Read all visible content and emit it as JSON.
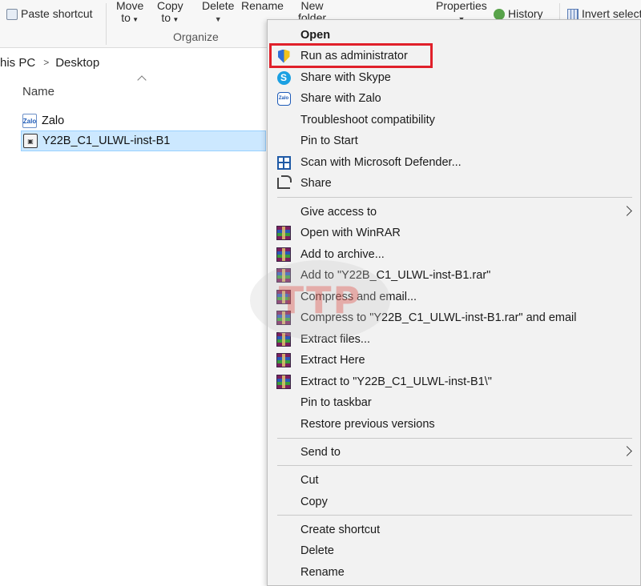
{
  "ribbon": {
    "paste_shortcut": "Paste shortcut",
    "move_to": [
      "Move",
      "to"
    ],
    "copy_to": [
      "Copy",
      "to"
    ],
    "delete": "Delete",
    "rename": "Rename",
    "new_folder": [
      "New",
      "folder"
    ],
    "properties": "Properties",
    "history": "History",
    "invert_selection": "Invert select",
    "organize_label": "Organize"
  },
  "address": {
    "segments": [
      "his PC",
      "Desktop"
    ]
  },
  "file_list": {
    "column_name": "Name",
    "files": [
      {
        "name": "Zalo",
        "icon": "zalo-icon",
        "selected": false
      },
      {
        "name": "Y22B_C1_ULWL-inst-B1",
        "icon": "installer-icon",
        "selected": true
      }
    ]
  },
  "context_menu": {
    "items": [
      {
        "label": "Open",
        "bold": true,
        "icon": null
      },
      {
        "label": "Run as administrator",
        "icon": "uac-shield-icon",
        "highlighted": true
      },
      {
        "label": "Share with Skype",
        "icon": "skype-icon"
      },
      {
        "label": "Share with Zalo",
        "icon": "zalo-icon"
      },
      {
        "label": "Troubleshoot compatibility",
        "icon": null
      },
      {
        "label": "Pin to Start",
        "icon": null
      },
      {
        "label": "Scan with Microsoft Defender...",
        "icon": "defender-icon"
      },
      {
        "label": "Share",
        "icon": "share-icon"
      },
      {
        "label": "Give access to",
        "icon": null,
        "submenu": true
      },
      {
        "label": "Open with WinRAR",
        "icon": "winrar-icon"
      },
      {
        "label": "Add to archive...",
        "icon": "winrar-icon"
      },
      {
        "label": "Add to \"Y22B_C1_ULWL-inst-B1.rar\"",
        "icon": "winrar-icon"
      },
      {
        "label": "Compress and email...",
        "icon": "winrar-icon"
      },
      {
        "label": "Compress to \"Y22B_C1_ULWL-inst-B1.rar\" and email",
        "icon": "winrar-icon"
      },
      {
        "label": "Extract files...",
        "icon": "winrar-icon"
      },
      {
        "label": "Extract Here",
        "icon": "winrar-icon"
      },
      {
        "label": "Extract to \"Y22B_C1_ULWL-inst-B1\\\"",
        "icon": "winrar-icon"
      },
      {
        "label": "Pin to taskbar",
        "icon": null
      },
      {
        "label": "Restore previous versions",
        "icon": null
      },
      {
        "label": "Send to",
        "icon": null,
        "submenu": true
      },
      {
        "label": "Cut",
        "icon": null
      },
      {
        "label": "Copy",
        "icon": null
      },
      {
        "label": "Create shortcut",
        "icon": null
      },
      {
        "label": "Delete",
        "icon": null
      },
      {
        "label": "Rename",
        "icon": null
      }
    ],
    "highlight_color": "#e0202a"
  },
  "watermark": {
    "text": "TTP"
  }
}
